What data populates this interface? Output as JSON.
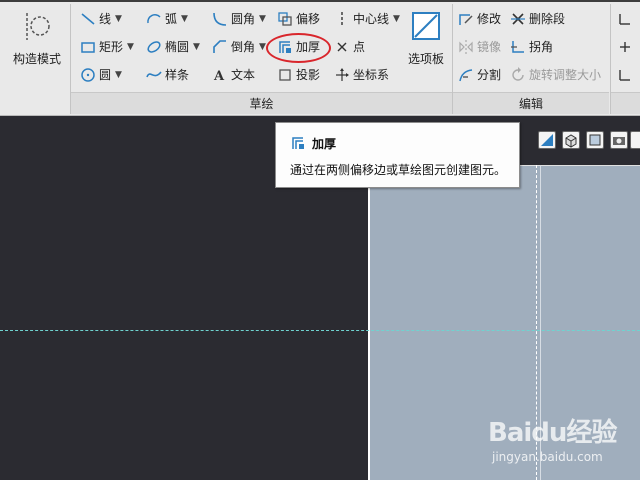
{
  "ribbon": {
    "construct_mode_label": "构造模式",
    "draw_group": {
      "label": "草绘",
      "line": "线",
      "rectangle": "矩形",
      "circle": "圆",
      "arc": "弧",
      "ellipse": "椭圆",
      "spline": "样条",
      "fillet": "圆角",
      "chamfer": "倒角",
      "text": "文本",
      "offset": "偏移",
      "thicken": "加厚",
      "project": "投影",
      "centerline": "中心线",
      "point": "点",
      "coordinate_system": "坐标系",
      "palette": "选项板"
    },
    "edit_group": {
      "label": "编辑",
      "modify": "修改",
      "mirror": "镜像",
      "divide": "分割",
      "delete_segment": "删除段",
      "corner": "拐角",
      "rotate_resize": "旋转调整大小"
    }
  },
  "tooltip": {
    "title": "加厚",
    "description": "通过在两侧偏移边或草绘图元创建图元。"
  },
  "watermark": {
    "brand": "Baidu经验",
    "url": "jingyan.baidu.com"
  },
  "colors": {
    "ribbon_bg": "#e9e9e9",
    "canvas_bg": "#2b2b31",
    "viewport_bg": "#a0aebd",
    "highlight": "#d9262c",
    "icon_blue": "#2d7fc1",
    "guide_dash": "#6fd3d0"
  }
}
